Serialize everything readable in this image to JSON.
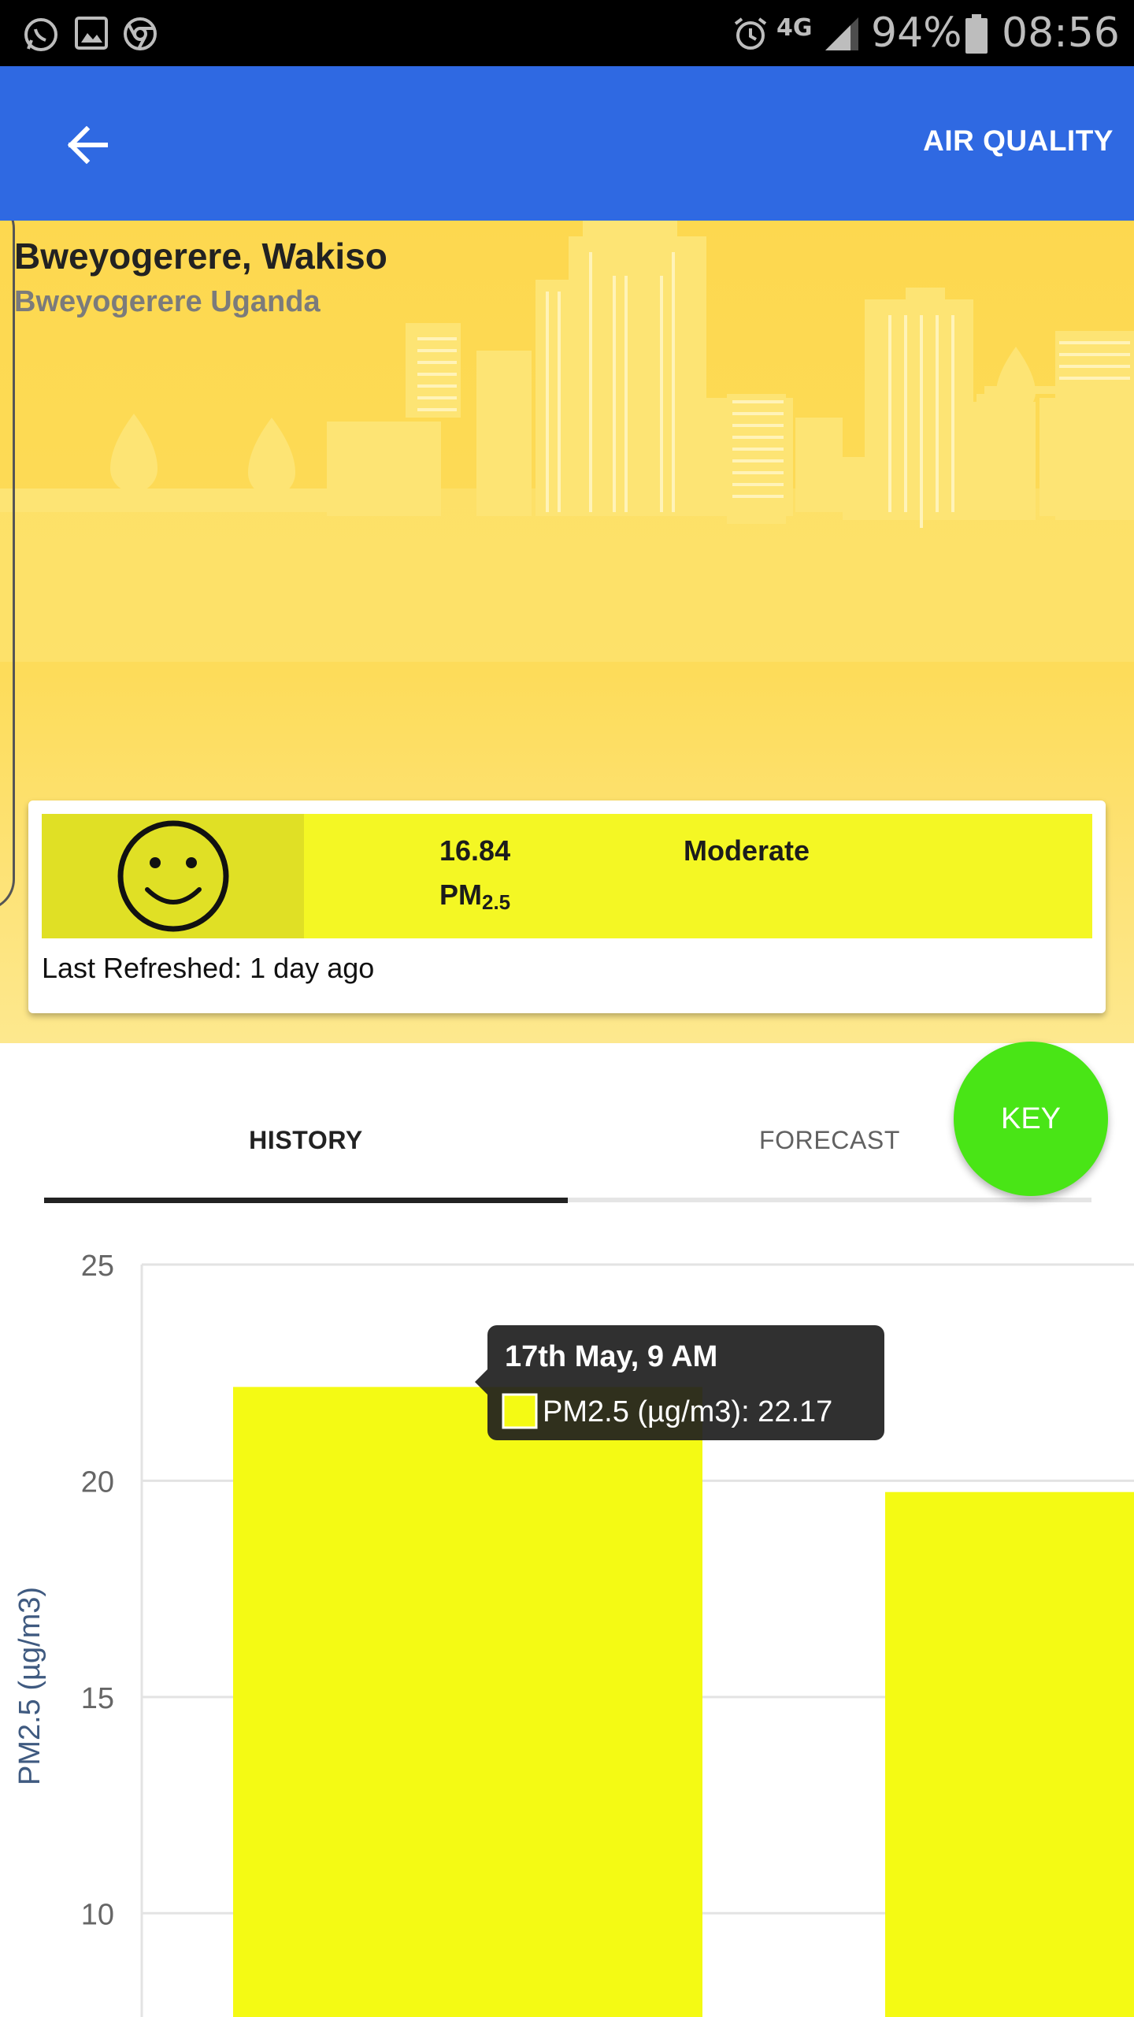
{
  "status_bar": {
    "battery": "94%",
    "time": "08:56",
    "network": "4G"
  },
  "app_bar": {
    "title": "AIR QUALITY"
  },
  "location": {
    "name": "Bweyogerere, Wakiso",
    "subtitle": "Bweyogerere Uganda"
  },
  "aqi_card": {
    "value": "16.84",
    "unit_main": "PM",
    "unit_sub": "2.5",
    "category": "Moderate",
    "last_refreshed": "Last Refreshed: 1 day ago",
    "strip_color": "#f4f724",
    "face_color": "#e0e025"
  },
  "tabs": [
    {
      "label": "HISTORY",
      "active": true
    },
    {
      "label": "FORECAST",
      "active": false
    }
  ],
  "key_button": {
    "label": "KEY",
    "color": "#49e516"
  },
  "chart_data": {
    "type": "bar",
    "ylabel": "PM2.5 (µg/m3)",
    "yticks": [
      10,
      15,
      20,
      25
    ],
    "ylim_visible": [
      7.6,
      25
    ],
    "bar_color": "#f4fa14",
    "series": [
      {
        "name": "PM2.5 (µg/m3)",
        "values": [
          22.17,
          19.74
        ]
      }
    ],
    "tooltip": {
      "title": "17th May, 9 AM",
      "label": "PM2.5 (µg/m3): 22.17"
    }
  }
}
